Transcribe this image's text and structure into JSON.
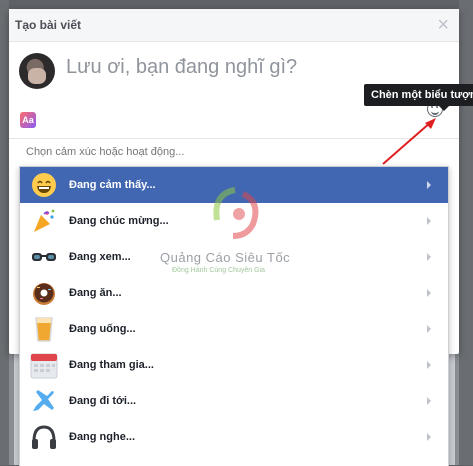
{
  "modal": {
    "title": "Tạo bài viết",
    "close": "×",
    "placeholder": "Lưu ơi, bạn đang nghĩ gì?",
    "aa_badge": "Aa",
    "feeling_placeholder": "Chọn cảm xúc hoặc hoạt động..."
  },
  "tooltip": {
    "text": "Chèn một biểu tượng"
  },
  "watermark": {
    "title": "Quảng Cáo Siêu Tốc",
    "subtitle": "Đồng Hành Cùng Chuyên Gia"
  },
  "menu": {
    "items": [
      {
        "label": "Đang cảm thấy...",
        "icon": "grinning-face-icon"
      },
      {
        "label": "Đang chúc mừng...",
        "icon": "party-popper-icon"
      },
      {
        "label": "Đang xem...",
        "icon": "glasses-icon"
      },
      {
        "label": "Đang ăn...",
        "icon": "donut-icon"
      },
      {
        "label": "Đang uống...",
        "icon": "drink-icon"
      },
      {
        "label": "Đang tham gia...",
        "icon": "calendar-icon"
      },
      {
        "label": "Đang đi tới...",
        "icon": "airplane-icon"
      },
      {
        "label": "Đang nghe...",
        "icon": "headphones-icon"
      }
    ]
  },
  "colors": {
    "active": "#4267b2",
    "tooltip": "#1c1e21",
    "arrow": "#e02020"
  }
}
